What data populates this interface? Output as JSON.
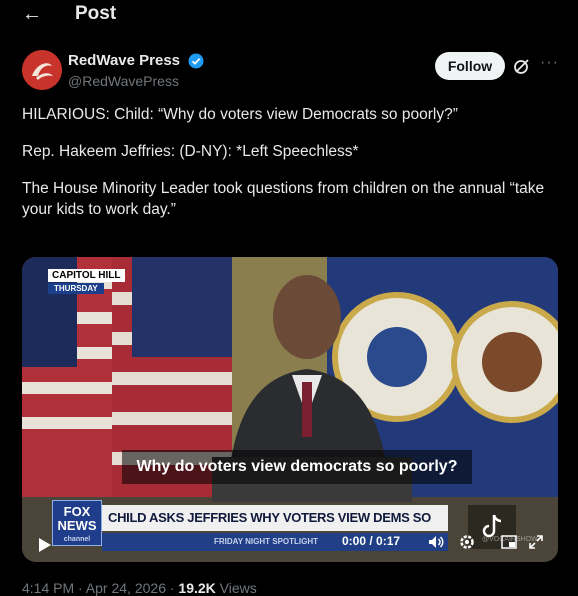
{
  "header": {
    "title": "Post"
  },
  "author": {
    "display_name": "RedWave Press",
    "handle": "@RedWavePress",
    "follow_label": "Follow"
  },
  "post": {
    "paragraphs": [
      "HILARIOUS: Child: “Why do voters view Democrats so poorly?”",
      "Rep. Hakeem Jeffries: (D-NY): *Left Speechless*",
      "The House Minority Leader took questions from children on the annual “take your kids to work day.”"
    ]
  },
  "video": {
    "location_tag": "CAPITOL HILL",
    "day_tag": "THURSDAY",
    "caption": "Why do voters view democrats so poorly?",
    "network_logo_line1": "FOX",
    "network_logo_line2": "NEWS",
    "network_logo_line3": "channel",
    "headline": "CHILD ASKS JEFFRIES WHY VOTERS VIEW DEMS SO POORLY",
    "sub_banner": "FRIDAY NIGHT SPOTLIGHT",
    "time": "0:00 / 0:17",
    "watermark": "@VOCAIRSHOW"
  },
  "meta": {
    "timestamp": "4:14 PM · Apr 24, 2026 · ",
    "views_count": "19.2K",
    "views_label": " Views"
  },
  "colors": {
    "background": "#000000",
    "text": "#e7e9ea",
    "muted": "#71767b",
    "verified": "#1d9bf0",
    "follow_bg": "#eff3f4"
  }
}
